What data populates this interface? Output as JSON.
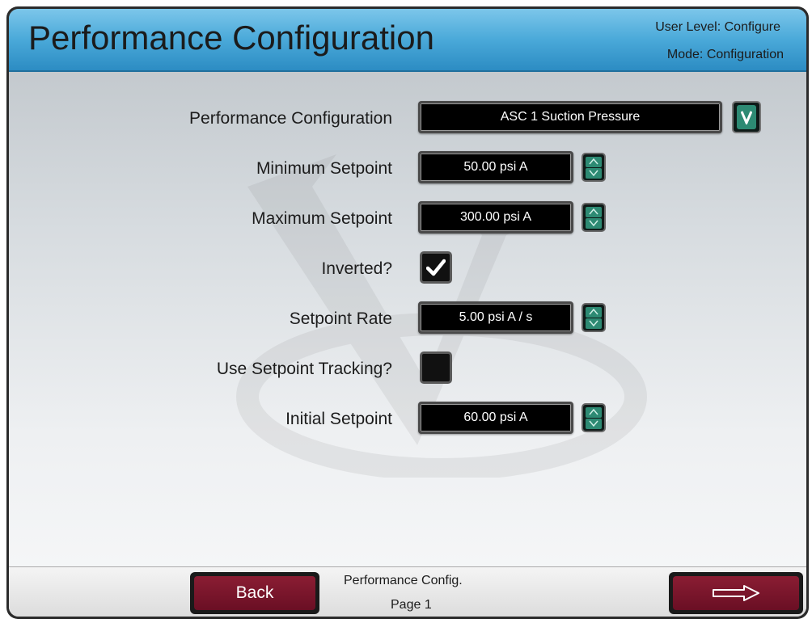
{
  "header": {
    "title": "Performance Configuration",
    "user_level": "User Level: Configure",
    "mode": "Mode: Configuration"
  },
  "form": {
    "performance_configuration": {
      "label": "Performance Configuration",
      "value": "ASC 1 Suction Pressure"
    },
    "minimum_setpoint": {
      "label": "Minimum Setpoint",
      "value": "50.00 psi A"
    },
    "maximum_setpoint": {
      "label": "Maximum Setpoint",
      "value": "300.00 psi A"
    },
    "inverted": {
      "label": "Inverted?",
      "checked": true
    },
    "setpoint_rate": {
      "label": "Setpoint Rate",
      "value": "5.00 psi A / s"
    },
    "use_setpoint_tracking": {
      "label": "Use Setpoint Tracking?",
      "checked": false
    },
    "initial_setpoint": {
      "label": "Initial Setpoint",
      "value": "60.00 psi A"
    }
  },
  "footer": {
    "back_label": "Back",
    "page_name": "Performance Config.",
    "page_number": "Page 1"
  },
  "icons": {
    "dropdown": "chevron-down-icon",
    "stepper_up": "arrow-up-icon",
    "stepper_down": "arrow-down-icon",
    "check": "checkmark-icon",
    "next": "arrow-right-icon"
  },
  "colors": {
    "header_blue": "#4aa9d9",
    "button_maroon": "#7a1530",
    "stepper_teal": "#2d8a73",
    "value_box": "#000000"
  }
}
